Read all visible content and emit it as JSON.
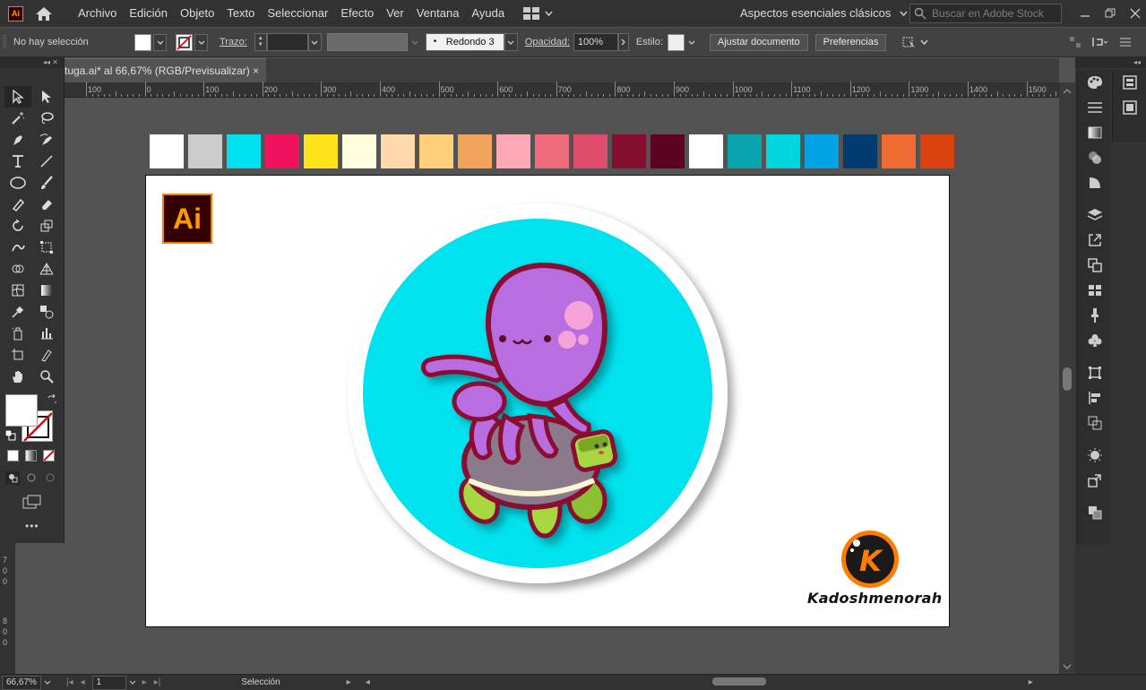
{
  "app": {
    "logo_text": "Ai",
    "menu": [
      "Archivo",
      "Edición",
      "Objeto",
      "Texto",
      "Seleccionar",
      "Efecto",
      "Ver",
      "Ventana",
      "Ayuda"
    ],
    "workspace": "Aspectos esenciales clásicos",
    "stock_placeholder": "Buscar en Adobe Stock"
  },
  "control": {
    "selection_status": "No hay selección",
    "stroke_label": "Trazo:",
    "brush_value": "Redondo 3 ...",
    "opacity_label": "Opacidad:",
    "opacity_value": "100%",
    "style_label": "Estilo:",
    "adjust_doc_button": "Ajustar documento",
    "prefs_button": "Preferencias"
  },
  "document": {
    "tab_title": "tuga.ai* al 66,67% (RGB/Previsualizar)",
    "close_glyph": "×"
  },
  "ruler": {
    "ticks": [
      "100",
      "0",
      "100",
      "200",
      "300",
      "400",
      "500",
      "600",
      "700",
      "800",
      "900",
      "1000",
      "1100",
      "1200",
      "1300",
      "1400",
      "1500"
    ],
    "left_ticks": [
      "7",
      "0",
      "0",
      "8",
      "0",
      "0"
    ]
  },
  "swatches": [
    "#ffffff",
    "#cccccc",
    "#00e1ef",
    "#f0125e",
    "#ffe31a",
    "#fffddc",
    "#ffd8ab",
    "#ffcf7a",
    "#f2a35b",
    "#ffa8b5",
    "#f06b7b",
    "#de4d6c",
    "#850d2d",
    "#5e0221",
    "#ffffff",
    "#0aa4af",
    "#00d4dd",
    "#00a3e3",
    "#013b70",
    "#ee6b31",
    "#d9420c"
  ],
  "artboard": {
    "badge_text": "Ai",
    "brand_logo_letter": "K",
    "brand_name": "Kadoshmenorah",
    "colors": {
      "circle_bg": "#00e3ef",
      "octopus": "#b86ee0",
      "outline": "#8a1030",
      "turtle": "#a8d840",
      "shell": "#8a7a8c",
      "brand_orange": "#ff7c00"
    }
  },
  "status": {
    "zoom": "66,67%",
    "page": "1",
    "tool": "Selección"
  }
}
